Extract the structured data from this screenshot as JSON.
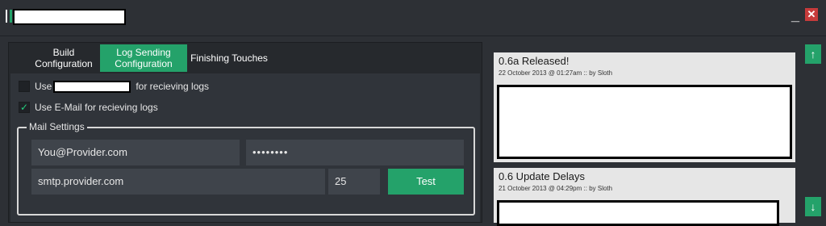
{
  "window": {
    "minimize_glyph": "_",
    "close_glyph": "✕",
    "accent": "#24a26a",
    "close_color": "#c63b3b"
  },
  "tabs": {
    "build": "Build\nConfiguration",
    "log": "Log Sending\nConfiguration",
    "finish": "Finishing Touches"
  },
  "logs": {
    "option1_prefix": "Use",
    "option1_suffix": "for recieving logs",
    "option2_label": "Use E-Mail for recieving logs",
    "option2_check": "✓"
  },
  "mail": {
    "legend": "Mail Settings",
    "email_value": "You@Provider.com",
    "password_value": "••••••••",
    "server_value": "smtp.provider.com",
    "port_value": "25",
    "test_label": "Test"
  },
  "news": {
    "items": [
      {
        "title": "0.6a Released!",
        "meta": "22 October 2013 @ 01:27am :: by Sloth"
      },
      {
        "title": "0.6 Update Delays",
        "meta": "21 October 2013 @ 04:29pm :: by Sloth"
      }
    ],
    "scroll_up": "↑",
    "scroll_down": "↓"
  }
}
